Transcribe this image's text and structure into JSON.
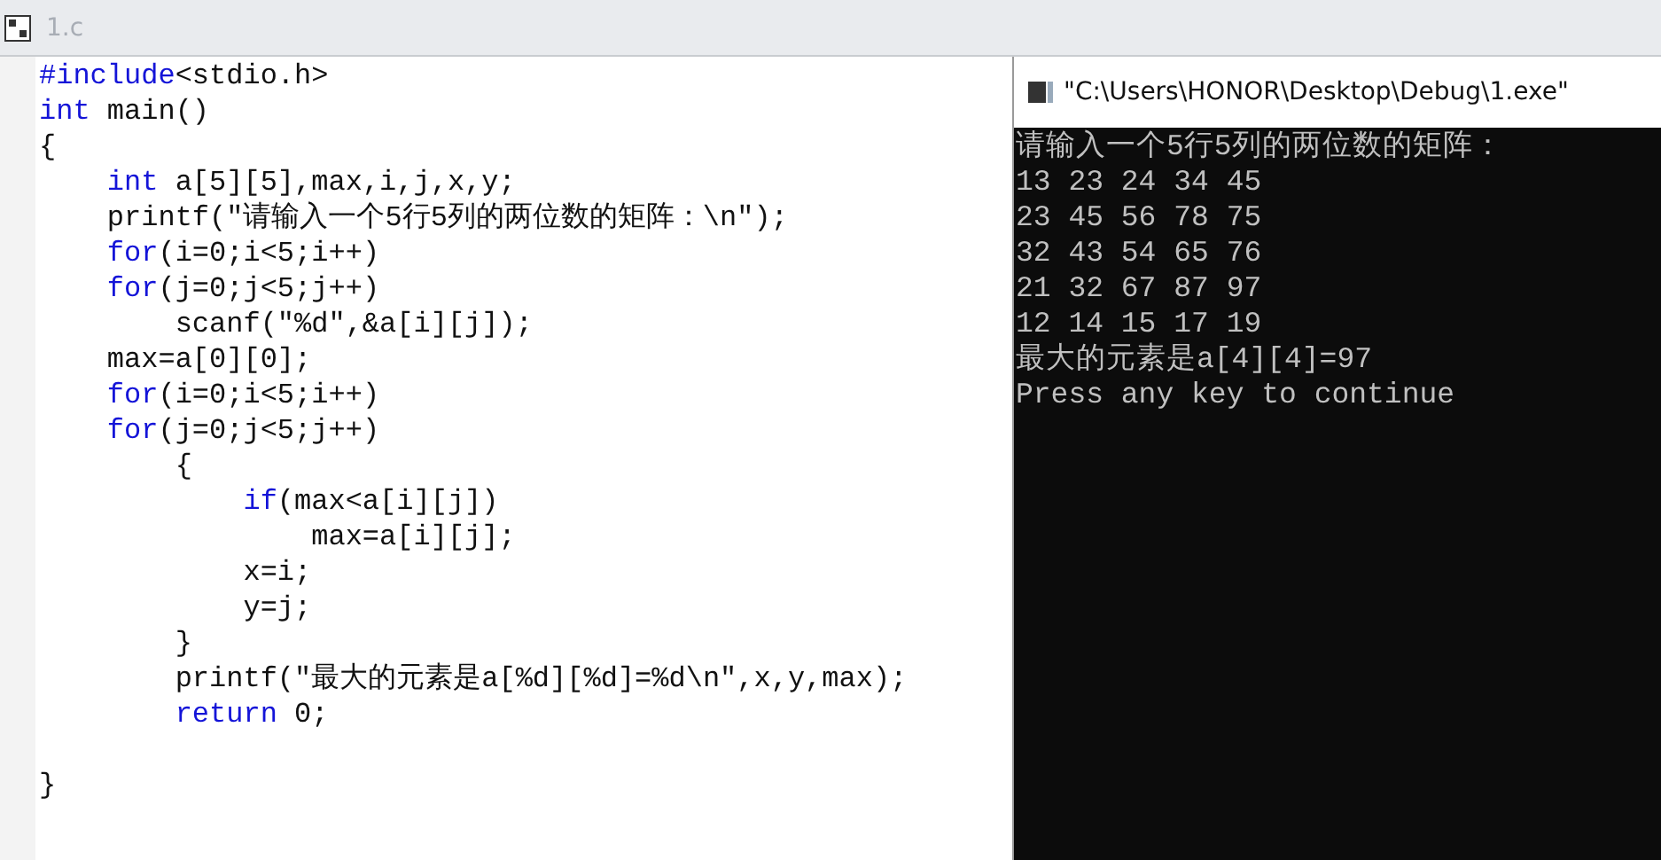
{
  "tab": {
    "title": "1.c",
    "selected": false
  },
  "code": [
    {
      "segments": [
        {
          "text": "#include",
          "kind": "keyword"
        },
        {
          "text": "<stdio.h>",
          "kind": "plain"
        }
      ]
    },
    {
      "segments": [
        {
          "text": "int",
          "kind": "keyword"
        },
        {
          "text": " main()",
          "kind": "plain"
        }
      ]
    },
    {
      "segments": [
        {
          "text": "{",
          "kind": "plain"
        }
      ]
    },
    {
      "segments": [
        {
          "text": "    int",
          "kind": "keyword"
        },
        {
          "text": " a[5][5],max,i,j,x,y;",
          "kind": "plain"
        }
      ]
    },
    {
      "segments": [
        {
          "text": "    printf(\"请输入一个5行5列的两位数的矩阵：\\n\");",
          "kind": "plain"
        }
      ]
    },
    {
      "segments": [
        {
          "text": "    for",
          "kind": "keyword"
        },
        {
          "text": "(i=0;i<5;i++)",
          "kind": "plain"
        }
      ]
    },
    {
      "segments": [
        {
          "text": "    for",
          "kind": "keyword"
        },
        {
          "text": "(j=0;j<5;j++)",
          "kind": "plain"
        }
      ]
    },
    {
      "segments": [
        {
          "text": "        scanf(\"%d\",&a[i][j]);",
          "kind": "plain"
        }
      ]
    },
    {
      "segments": [
        {
          "text": "    max=a[0][0];",
          "kind": "plain"
        }
      ]
    },
    {
      "segments": [
        {
          "text": "    for",
          "kind": "keyword"
        },
        {
          "text": "(i=0;i<5;i++)",
          "kind": "plain"
        }
      ]
    },
    {
      "segments": [
        {
          "text": "    for",
          "kind": "keyword"
        },
        {
          "text": "(j=0;j<5;j++)",
          "kind": "plain"
        }
      ]
    },
    {
      "segments": [
        {
          "text": "        {",
          "kind": "plain"
        }
      ]
    },
    {
      "segments": [
        {
          "text": "            if",
          "kind": "keyword"
        },
        {
          "text": "(max<a[i][j])",
          "kind": "plain"
        }
      ]
    },
    {
      "segments": [
        {
          "text": "                max=a[i][j];",
          "kind": "plain"
        }
      ]
    },
    {
      "segments": [
        {
          "text": "            x=i;",
          "kind": "plain"
        }
      ]
    },
    {
      "segments": [
        {
          "text": "            y=j;",
          "kind": "plain"
        }
      ]
    },
    {
      "segments": [
        {
          "text": "        }",
          "kind": "plain"
        }
      ]
    },
    {
      "segments": [
        {
          "text": "        printf(\"最大的元素是a[%d][%d]=%d\\n\",x,y,max);",
          "kind": "plain"
        }
      ]
    },
    {
      "segments": [
        {
          "text": "        return",
          "kind": "keyword"
        },
        {
          "text": " 0;",
          "kind": "plain"
        }
      ]
    },
    {
      "kind": "blank"
    },
    {
      "segments": [
        {
          "text": "}",
          "kind": "plain"
        }
      ]
    }
  ],
  "console": {
    "title": "\"C:\\Users\\HONOR\\Desktop\\Debug\\1.exe\"",
    "lines": [
      "请输入一个5行5列的两位数的矩阵：",
      "13 23 24 34 45",
      "23 45 56 78 75",
      "32 43 54 65 76",
      "21 32 67 87 97",
      "12 14 15 17 19",
      "最大的元素是a[4][4]=97",
      "Press any key to continue"
    ]
  }
}
